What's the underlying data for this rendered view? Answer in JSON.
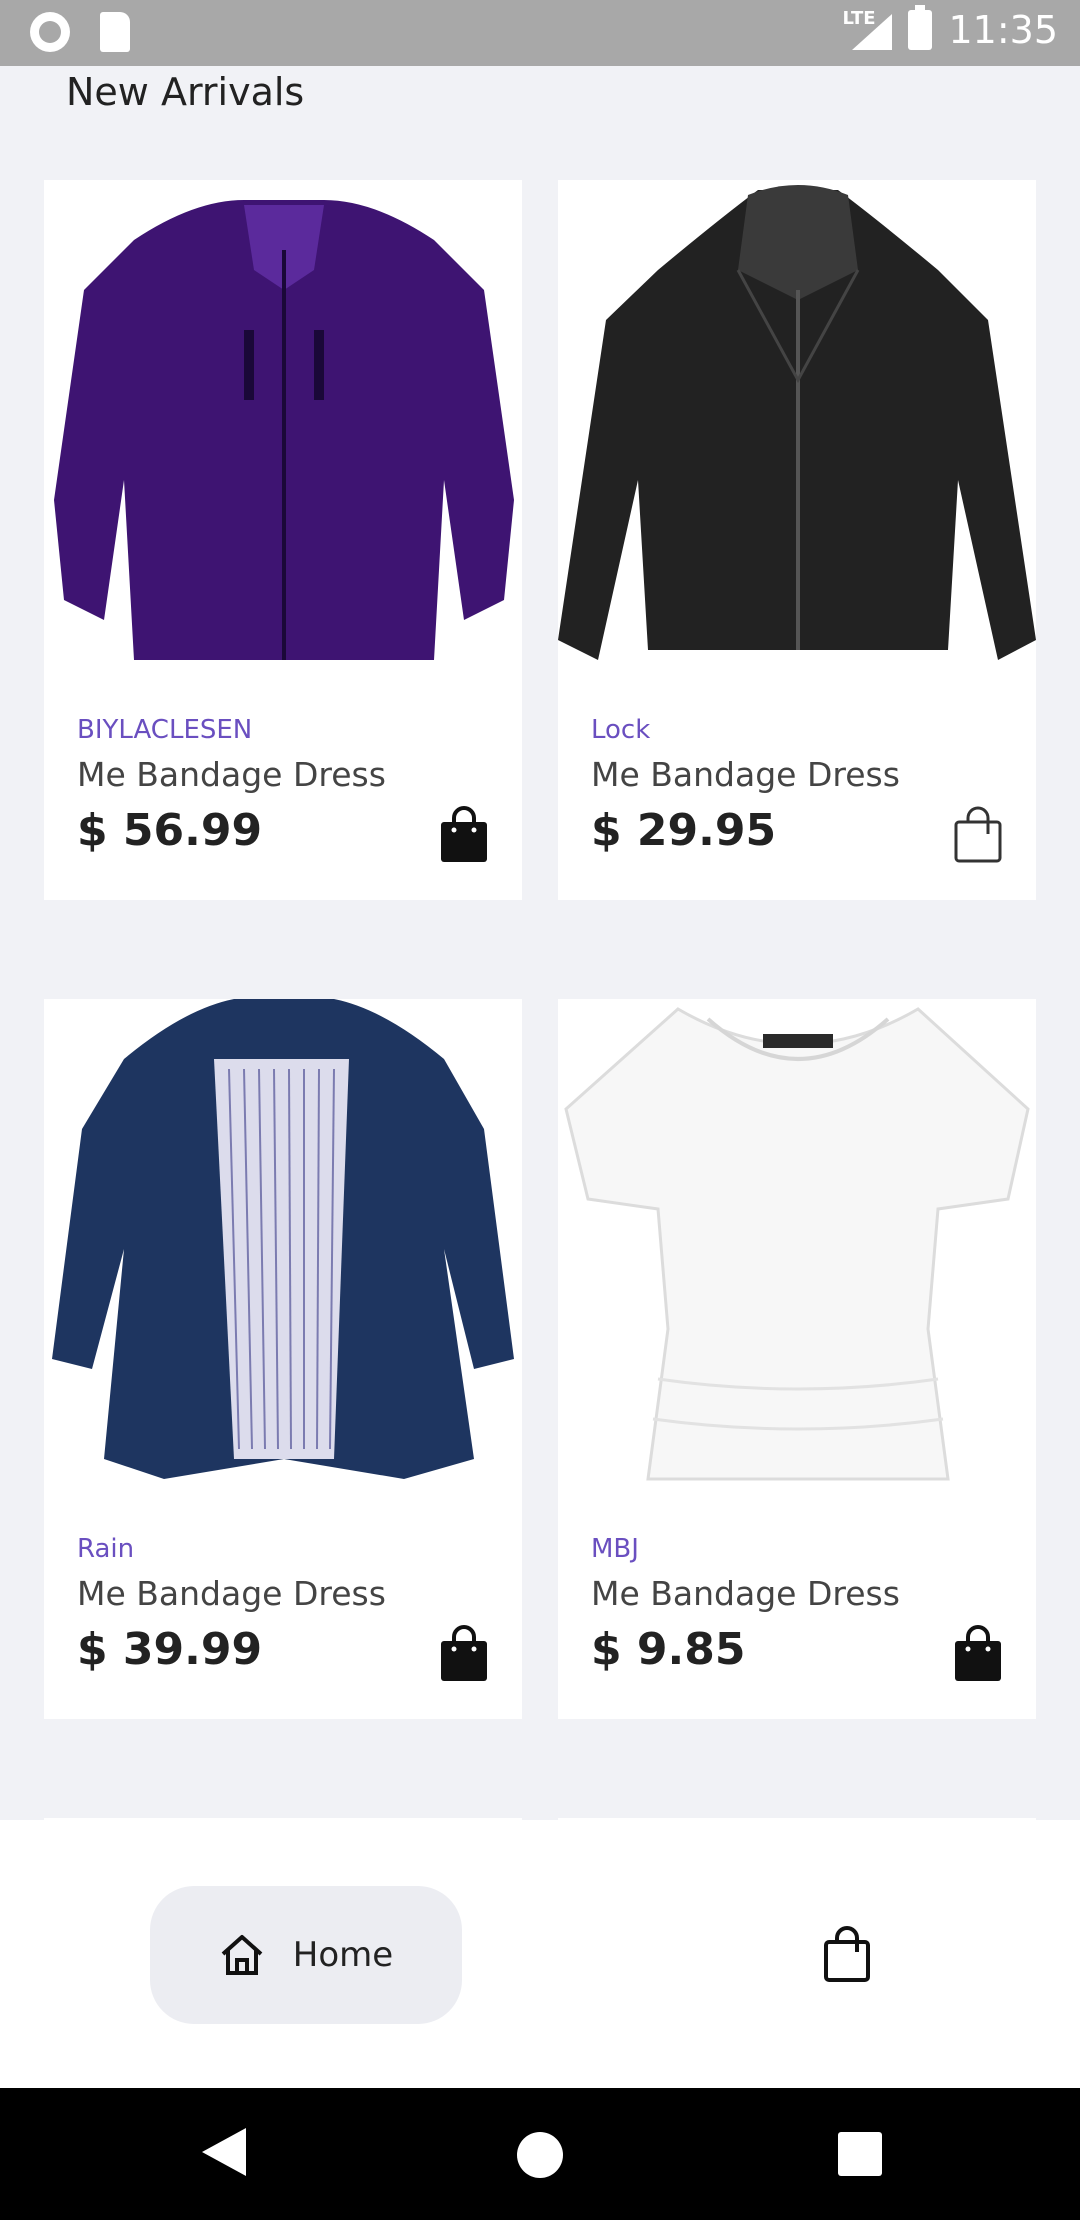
{
  "status_bar": {
    "network": "LTE",
    "time": "11:35"
  },
  "section_title": "New Arrivals",
  "products": [
    {
      "brand": "BIYLACLESEN",
      "name": "Me Bandage Dress",
      "price": "$ 56.99",
      "image": "purple-jacket",
      "color": "#3e1472",
      "in_cart": true
    },
    {
      "brand": "Lock",
      "name": "Me Bandage Dress",
      "price": "$ 29.95",
      "image": "black-leather-jacket",
      "color": "#222222",
      "in_cart": false
    },
    {
      "brand": "Rain",
      "name": "Me Bandage Dress",
      "price": "$ 39.99",
      "image": "navy-jacket",
      "color": "#1e3560",
      "in_cart": true
    },
    {
      "brand": "MBJ",
      "name": "Me Bandage Dress",
      "price": "$ 9.85",
      "image": "white-tshirt",
      "color": "#f5f5f5",
      "in_cart": true
    }
  ],
  "bottom_nav": {
    "home_label": "Home",
    "home_icon": "home-icon",
    "cart_icon": "shopping-bag-icon"
  },
  "accent_color": "#6a4fc0"
}
